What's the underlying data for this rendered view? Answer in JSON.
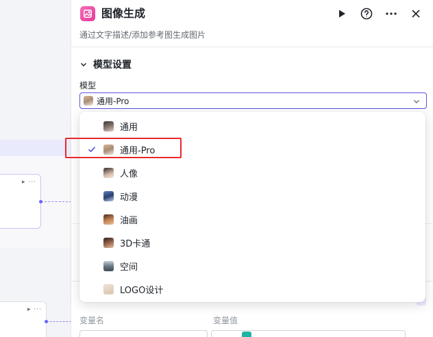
{
  "panel": {
    "title": "图像生成",
    "subtitle": "通过文字描述/添加参考图生成图片",
    "section_title": "模型设置",
    "model_label": "模型",
    "selected_model": "通用-Pro"
  },
  "dropdown": {
    "options": [
      {
        "label": "通用",
        "icon": "avatar-general"
      },
      {
        "label": "通用-Pro",
        "icon": "avatar-pro",
        "selected": true
      },
      {
        "label": "人像",
        "icon": "avatar-portrait"
      },
      {
        "label": "动漫",
        "icon": "avatar-anime"
      },
      {
        "label": "油画",
        "icon": "avatar-oil"
      },
      {
        "label": "3D卡通",
        "icon": "avatar-3d"
      },
      {
        "label": "空间",
        "icon": "avatar-space"
      },
      {
        "label": "LOGO设计",
        "icon": "avatar-logo"
      }
    ]
  },
  "lower": {
    "var_name_label": "变量名",
    "var_value_label": "变量值"
  },
  "colors": {
    "accent": "#5a52e0",
    "highlight": "#e8262b",
    "icon_brand": "#e43c9a"
  }
}
